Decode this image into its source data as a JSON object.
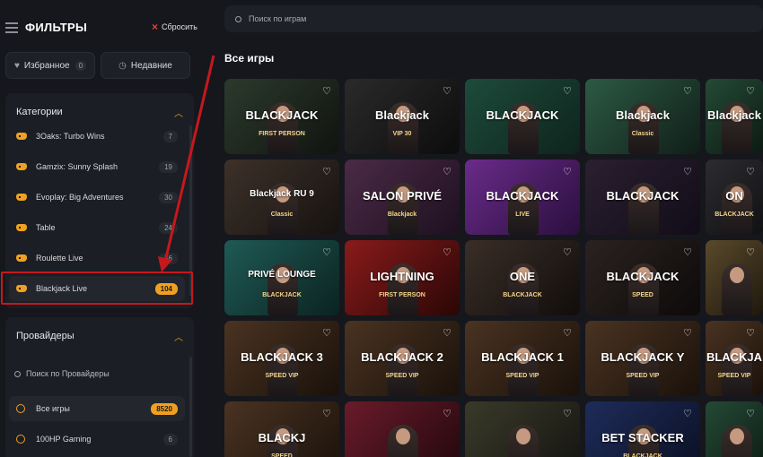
{
  "filters": {
    "title": "ФИЛЬТРЫ",
    "reset_label": "Сбросить",
    "favorites_label": "Избранное",
    "favorites_count": "0",
    "recent_label": "Недавние"
  },
  "categories": {
    "title": "Категории",
    "items": [
      {
        "label": "3Oaks: Turbo Wins",
        "count": "7"
      },
      {
        "label": "Gamzix: Sunny Splash",
        "count": "19"
      },
      {
        "label": "Evoplay: Big Adventures",
        "count": "30"
      },
      {
        "label": "Table",
        "count": "24"
      },
      {
        "label": "Roulette Live",
        "count": "56"
      },
      {
        "label": "Blackjack Live",
        "count": "104"
      }
    ]
  },
  "providers": {
    "title": "Провайдеры",
    "search_placeholder": "Поиск по Провайдеры",
    "items": [
      {
        "label": "Все игры",
        "count": "8520"
      },
      {
        "label": "100HP Gaming",
        "count": "6"
      }
    ]
  },
  "main": {
    "search_placeholder": "Поиск по играм",
    "section_title": "Все игры"
  },
  "tiles": [
    {
      "title": "BLACKJACK",
      "sub": "FIRST PERSON"
    },
    {
      "title": "Blackjack",
      "sub": "VIP 30"
    },
    {
      "title": "BLACKJACK",
      "sub": ""
    },
    {
      "title": "Blackjack",
      "sub": "Classic"
    },
    {
      "title": "Blackjack",
      "sub": ""
    },
    {
      "title": "Blackjack RU 9",
      "sub": "Classic"
    },
    {
      "title": "SALON PRIVÉ",
      "sub": "Blackjack"
    },
    {
      "title": "BLACKJACK",
      "sub": "LIVE"
    },
    {
      "title": "BLACKJACK",
      "sub": ""
    },
    {
      "title": "ON",
      "sub": "BLACKJACK"
    },
    {
      "title": "PRIVÉ LOUNGE",
      "sub": "BLACKJACK"
    },
    {
      "title": "LIGHTNING",
      "sub": "FIRST PERSON"
    },
    {
      "title": "ONE",
      "sub": "BLACKJACK"
    },
    {
      "title": "BLACKJACK",
      "sub": "SPEED"
    },
    {
      "title": "",
      "sub": ""
    },
    {
      "title": "BLACKJACK 3",
      "sub": "SPEED VIP"
    },
    {
      "title": "BLACKJACK 2",
      "sub": "SPEED VIP"
    },
    {
      "title": "BLACKJACK 1",
      "sub": "SPEED VIP"
    },
    {
      "title": "BLACKJACK Y",
      "sub": "SPEED VIP"
    },
    {
      "title": "BLACKJA",
      "sub": "SPEED VIP"
    },
    {
      "title": "BLACKJ",
      "sub": "SPEED"
    },
    {
      "title": "",
      "sub": ""
    },
    {
      "title": "",
      "sub": ""
    },
    {
      "title": "BET STACKER",
      "sub": "BLACKJACK"
    },
    {
      "title": "",
      "sub": ""
    }
  ]
}
